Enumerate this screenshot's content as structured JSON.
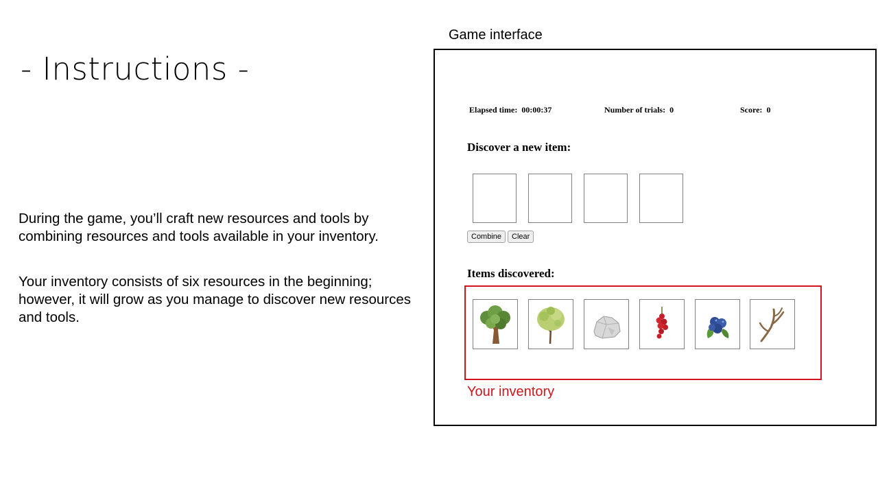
{
  "slide": {
    "title": "- Instructions -",
    "paragraphs": [
      "During the game, you’ll craft new resources and tools by combining resources and tools available in your inventory.",
      "Your inventory consists of six resources in the beginning; however, it will grow as you manage to discover new resources and tools."
    ],
    "panel_caption": "Game interface"
  },
  "game": {
    "status": {
      "elapsed_label": "Elapsed time:",
      "elapsed_value": "00:00:37",
      "trials_label": "Number of trials:",
      "trials_value": "0",
      "score_label": "Score:",
      "score_value": "0"
    },
    "discover_heading": "Discover a new item:",
    "buttons": {
      "combine": "Combine",
      "clear": "Clear"
    },
    "items_heading": "Items discovered:",
    "inventory_items": [
      {
        "icon": "oak-tree-icon"
      },
      {
        "icon": "young-tree-icon"
      },
      {
        "icon": "rock-icon"
      },
      {
        "icon": "red-berries-icon"
      },
      {
        "icon": "blueberries-icon"
      },
      {
        "icon": "antler-icon"
      }
    ]
  },
  "annotation": {
    "inventory_label": "Your inventory",
    "highlight_color": "#d0161c"
  }
}
